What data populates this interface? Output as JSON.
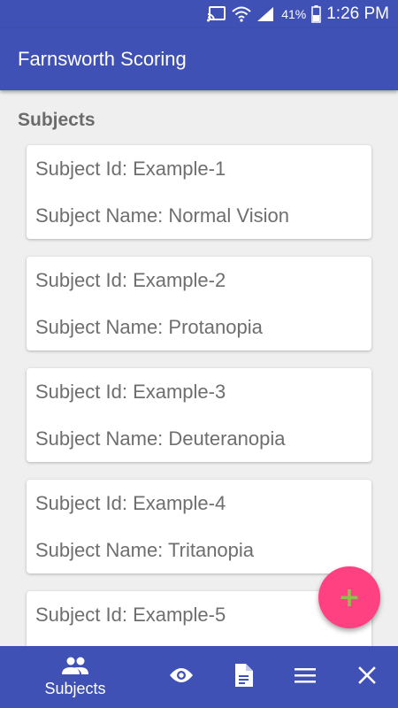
{
  "status_bar": {
    "battery_percent": "41%",
    "time": "1:26 PM",
    "icons": [
      "cast-icon",
      "wifi-icon",
      "signal-icon",
      "battery-icon"
    ]
  },
  "app_bar": {
    "title": "Farnsworth Scoring"
  },
  "section": {
    "title": "Subjects"
  },
  "subjects": [
    {
      "id_text": "Subject Id: Example-1",
      "name_text": "Subject Name: Normal Vision"
    },
    {
      "id_text": "Subject Id: Example-2",
      "name_text": "Subject Name: Protanopia"
    },
    {
      "id_text": "Subject Id: Example-3",
      "name_text": "Subject Name: Deuteranopia"
    },
    {
      "id_text": "Subject Id: Example-4",
      "name_text": "Subject Name: Tritanopia"
    },
    {
      "id_text": "Subject Id: Example-5",
      "name_text": ""
    }
  ],
  "fab": {
    "label": "+",
    "icon": "add-icon"
  },
  "bottom_nav": {
    "items": [
      {
        "icon": "people-icon",
        "label": "Subjects"
      },
      {
        "icon": "eye-icon"
      },
      {
        "icon": "document-icon"
      },
      {
        "icon": "menu-icon"
      },
      {
        "icon": "close-icon"
      }
    ]
  },
  "colors": {
    "primary": "#3f51b5",
    "accent": "#ff4081",
    "fab_glyph": "#8bc34a",
    "background": "#efefef"
  }
}
